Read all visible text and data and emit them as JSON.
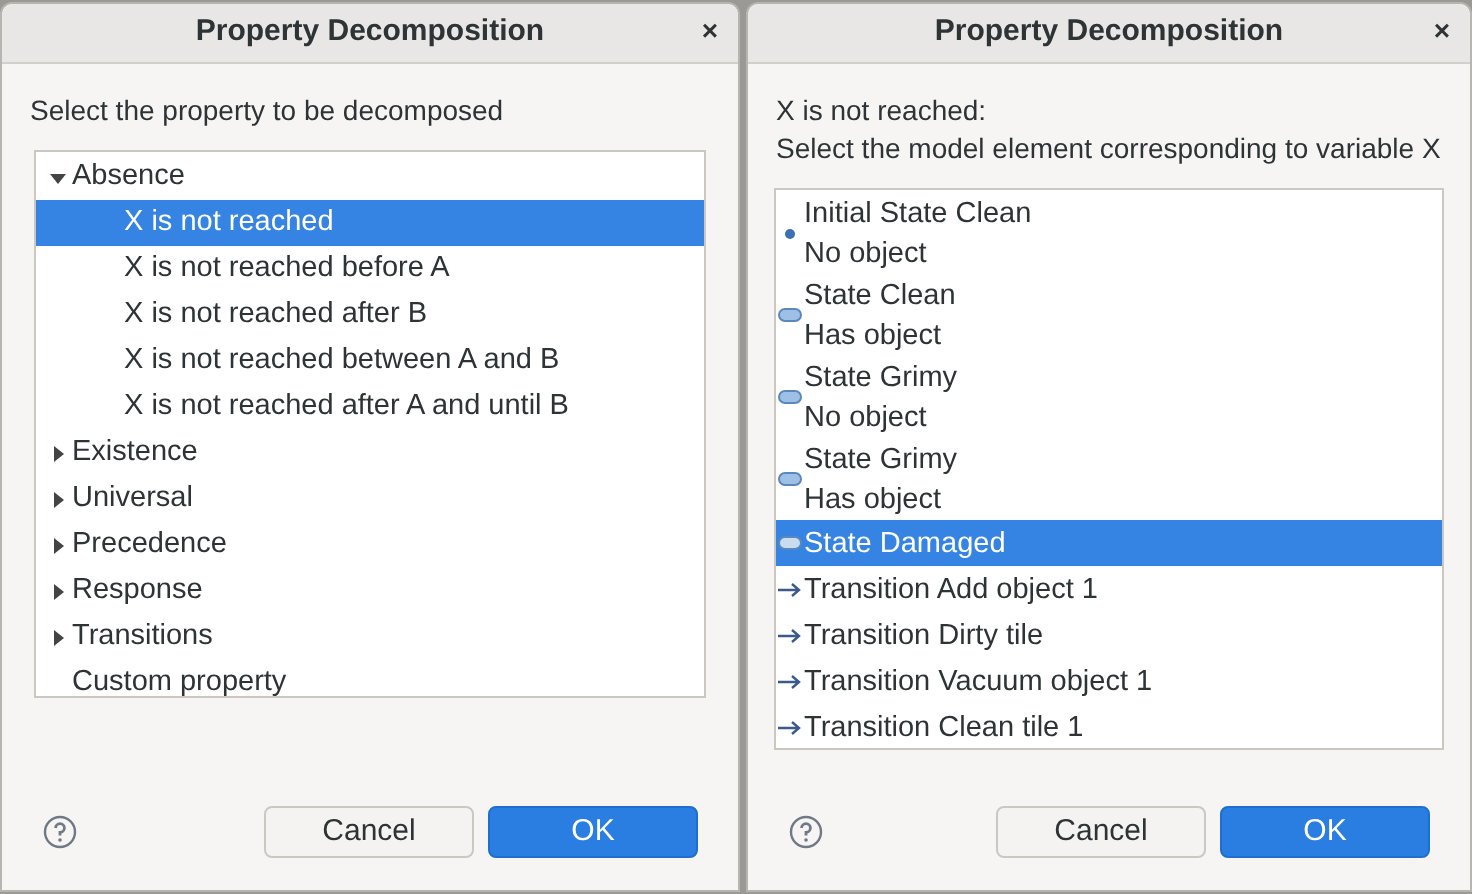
{
  "dialogs": [
    {
      "title": "Property Decomposition",
      "close": "×",
      "prompt": [
        "Select the property to be decomposed"
      ],
      "tree": [
        {
          "label": "Absence",
          "expanded": true,
          "selected": false,
          "children": [
            {
              "label": "X is not reached",
              "selected": true
            },
            {
              "label": "X is not reached before A",
              "selected": false
            },
            {
              "label": "X is not reached after B",
              "selected": false
            },
            {
              "label": "X is not reached between A and B",
              "selected": false
            },
            {
              "label": "X is not reached after A and until B",
              "selected": false
            }
          ]
        },
        {
          "label": "Existence",
          "expanded": false,
          "selected": false
        },
        {
          "label": "Universal",
          "expanded": false,
          "selected": false
        },
        {
          "label": "Precedence",
          "expanded": false,
          "selected": false
        },
        {
          "label": "Response",
          "expanded": false,
          "selected": false
        },
        {
          "label": "Transitions",
          "expanded": false,
          "selected": false
        },
        {
          "label": "Custom property",
          "selected": false
        }
      ],
      "buttons": [
        {
          "label": "Cancel",
          "kind": "secondary"
        },
        {
          "label": "OK",
          "kind": "primary"
        }
      ]
    },
    {
      "title": "Property Decomposition",
      "close": "×",
      "prompt": [
        "X is not reached:",
        "Select the model element corresponding to variable X"
      ],
      "list": [
        {
          "kind": "initial",
          "lines": [
            "Initial State Clean",
            "No object"
          ],
          "selected": false
        },
        {
          "kind": "state",
          "lines": [
            "State Clean",
            "Has object"
          ],
          "selected": false
        },
        {
          "kind": "state",
          "lines": [
            "State Grimy",
            "No object"
          ],
          "selected": false
        },
        {
          "kind": "state",
          "lines": [
            "State Grimy",
            "Has object"
          ],
          "selected": false
        },
        {
          "kind": "state",
          "lines": [
            "State Damaged"
          ],
          "selected": true
        },
        {
          "kind": "transition",
          "lines": [
            "Transition Add object 1"
          ],
          "selected": false
        },
        {
          "kind": "transition",
          "lines": [
            "Transition Dirty tile"
          ],
          "selected": false
        },
        {
          "kind": "transition",
          "lines": [
            "Transition Vacuum object 1"
          ],
          "selected": false
        },
        {
          "kind": "transition",
          "lines": [
            "Transition Clean tile 1"
          ],
          "selected": false
        }
      ],
      "buttons": [
        {
          "label": "Cancel",
          "kind": "secondary"
        },
        {
          "label": "OK",
          "kind": "primary"
        }
      ]
    }
  ]
}
